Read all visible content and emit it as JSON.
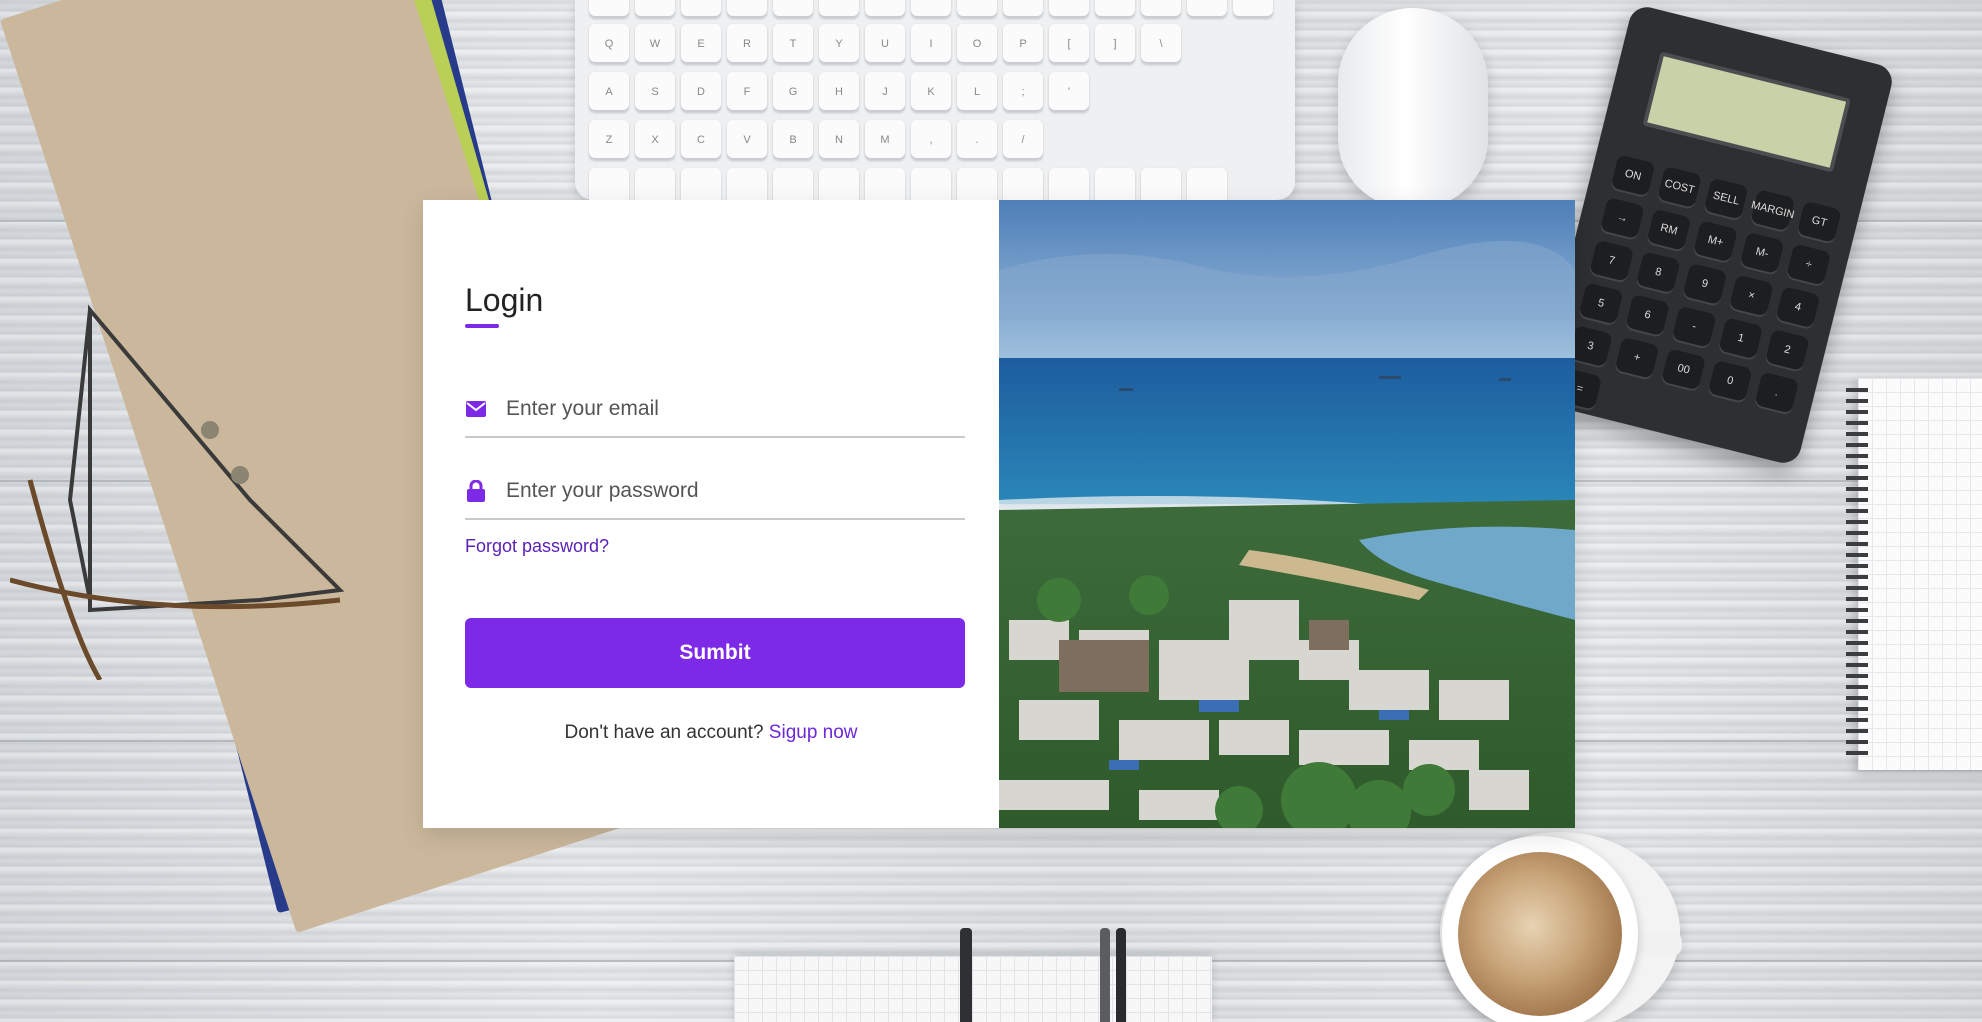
{
  "login": {
    "title": "Login",
    "email_placeholder": "Enter your email",
    "password_placeholder": "Enter your password",
    "forgot_password": "Forgot password?",
    "submit_label": "Sumbit",
    "signup_prompt": "Don't have an account?",
    "signup_link": "Sigup now"
  },
  "icons": {
    "email": "envelope-icon",
    "password": "lock-icon"
  },
  "colors": {
    "accent": "#7d2ae8",
    "link": "#5b21b6",
    "card_background": "#ffffff"
  },
  "keyboard": {
    "row1": [
      "Q",
      "W",
      "E",
      "R",
      "T",
      "Y",
      "U",
      "I",
      "O",
      "P",
      "[",
      "]",
      "\\"
    ],
    "row2": [
      "A",
      "S",
      "D",
      "F",
      "G",
      "H",
      "J",
      "K",
      "L",
      ";",
      "'"
    ],
    "row3": [
      "Z",
      "X",
      "C",
      "V",
      "B",
      "N",
      "M",
      ",",
      ".",
      "/"
    ]
  },
  "calculator": {
    "keys": [
      "ON",
      "COST",
      "SELL",
      "MARGIN",
      "GT",
      "→",
      "RM",
      "M+",
      "M-",
      "÷",
      "7",
      "8",
      "9",
      "×",
      "4",
      "5",
      "6",
      "-",
      "1",
      "2",
      "3",
      "+",
      "00",
      "0",
      ".",
      "="
    ]
  }
}
